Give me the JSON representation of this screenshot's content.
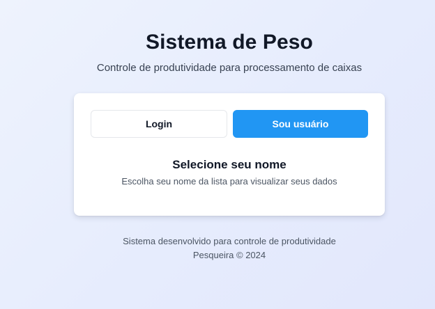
{
  "header": {
    "title": "Sistema de Peso",
    "subtitle": "Controle de produtividade para processamento de caixas"
  },
  "card": {
    "login_label": "Login",
    "user_label": "Sou usuário",
    "heading": "Selecione seu nome",
    "description": "Escolha seu nome da lista para visualizar seus dados"
  },
  "footer": {
    "line1": "Sistema desenvolvido para controle de produtividade",
    "line2": "Pesqueira © 2024"
  },
  "colors": {
    "accent": "#2196f3",
    "background": "#e6ecfd",
    "card": "#ffffff"
  }
}
